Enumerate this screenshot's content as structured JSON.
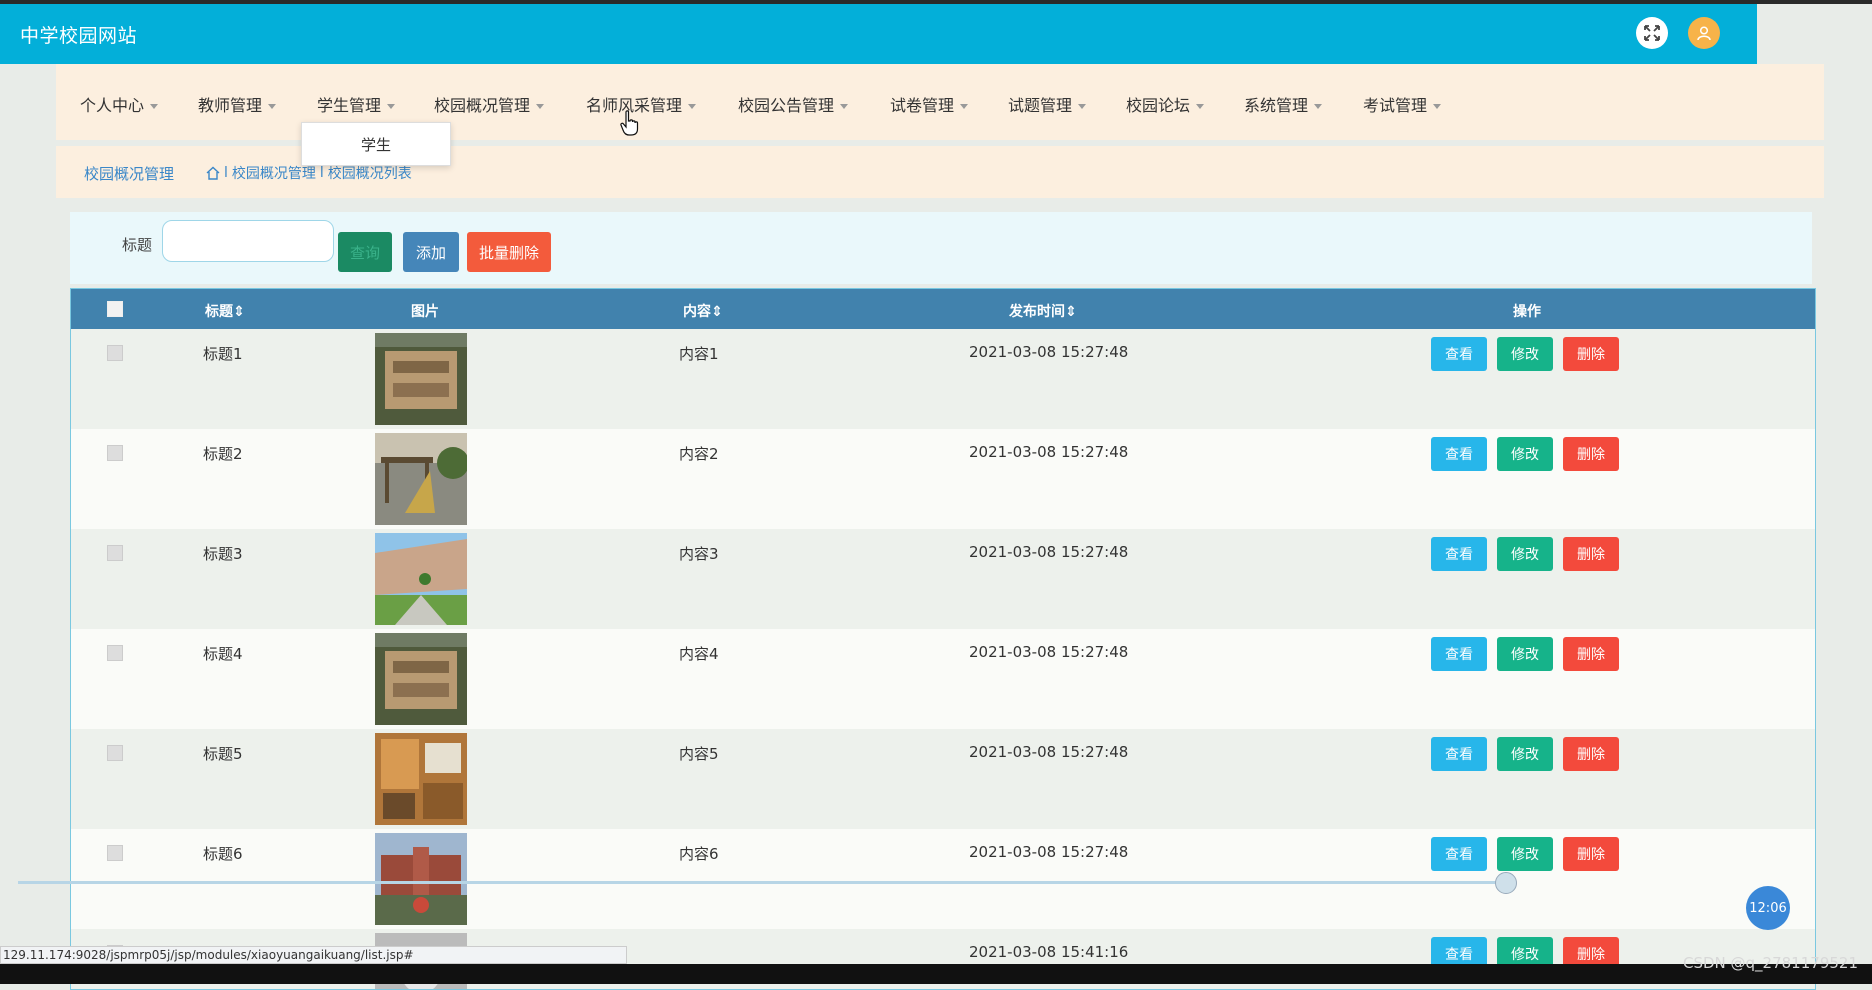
{
  "app": {
    "title": "中学校园网站"
  },
  "nav": {
    "items": [
      "个人中心",
      "教师管理",
      "学生管理",
      "校园概况管理",
      "名师风采管理",
      "校园公告管理",
      "试卷管理",
      "试题管理",
      "校园论坛",
      "系统管理",
      "考试管理"
    ],
    "open_dropdown": {
      "parent": "学生管理",
      "items": [
        "学生"
      ]
    }
  },
  "breadcrumb": {
    "title": "校园概况管理",
    "path": [
      "校园概况管理",
      "校园概况列表"
    ],
    "separator": "l"
  },
  "search": {
    "label": "标题",
    "value": "",
    "search_button": "查询",
    "add_button": "添加",
    "batch_delete_button": "批量删除"
  },
  "table": {
    "headers": [
      "标题",
      "图片",
      "内容",
      "发布时间",
      "操作"
    ],
    "sortable_marker": "⇕",
    "rows": [
      {
        "title": "标题1",
        "content": "内容1",
        "time": "2021-03-08 15:27:48",
        "image": "campus-aerial"
      },
      {
        "title": "标题2",
        "content": "内容2",
        "time": "2021-03-08 15:27:48",
        "image": "campus-sculpture"
      },
      {
        "title": "标题3",
        "content": "内容3",
        "time": "2021-03-08 15:27:48",
        "image": "campus-courtyard"
      },
      {
        "title": "标题4",
        "content": "内容4",
        "time": "2021-03-08 15:27:48",
        "image": "campus-aerial"
      },
      {
        "title": "标题5",
        "content": "内容5",
        "time": "2021-03-08 15:27:48",
        "image": "dorm-room"
      },
      {
        "title": "标题6",
        "content": "内容6",
        "time": "2021-03-08 15:27:48",
        "image": "campus-building"
      },
      {
        "title": "",
        "content": "",
        "time": "2021-03-08 15:41:16",
        "image": "portrait"
      }
    ],
    "actions": {
      "view": "查看",
      "edit": "修改",
      "delete": "删除"
    }
  },
  "status": {
    "url": "129.11.174:9028/jspmrp05j/jsp/modules/xiaoyuangaikuang/list.jsp#",
    "video_time": "12:06",
    "watermark": "CSDN @q_2781179521"
  },
  "colors": {
    "topbar": "#03afd9",
    "header": "#4182ad",
    "view": "#27b6ea",
    "edit": "#16b38a",
    "delete": "#f34a3c"
  }
}
